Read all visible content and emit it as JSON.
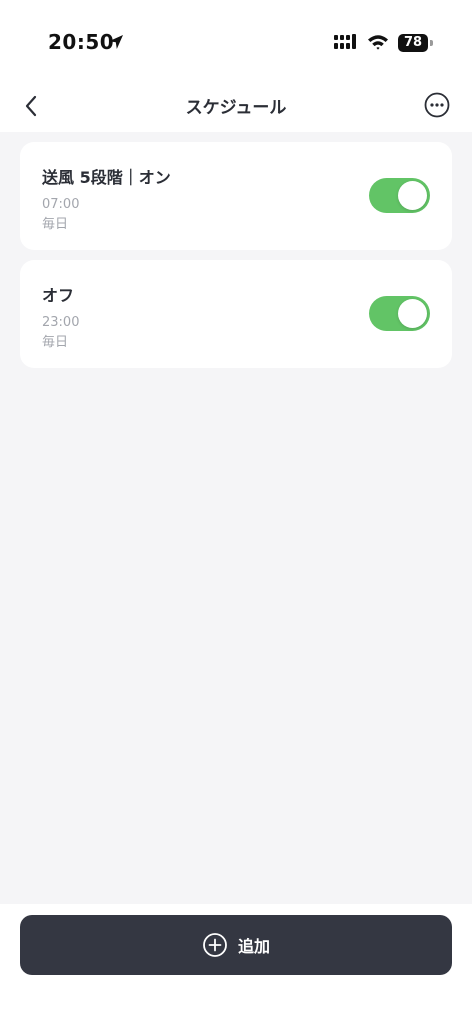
{
  "status_bar": {
    "time": "20:50",
    "battery": "78"
  },
  "header": {
    "title": "スケジュール"
  },
  "schedules": [
    {
      "title": "送風 5段階｜オン",
      "time": "07:00",
      "repeat": "毎日",
      "enabled": true
    },
    {
      "title": "オフ",
      "time": "23:00",
      "repeat": "毎日",
      "enabled": true
    }
  ],
  "footer": {
    "add_label": "追加"
  },
  "colors": {
    "toggle_on": "#62c466",
    "button_bg": "#343742",
    "page_bg": "#f5f5f7"
  }
}
